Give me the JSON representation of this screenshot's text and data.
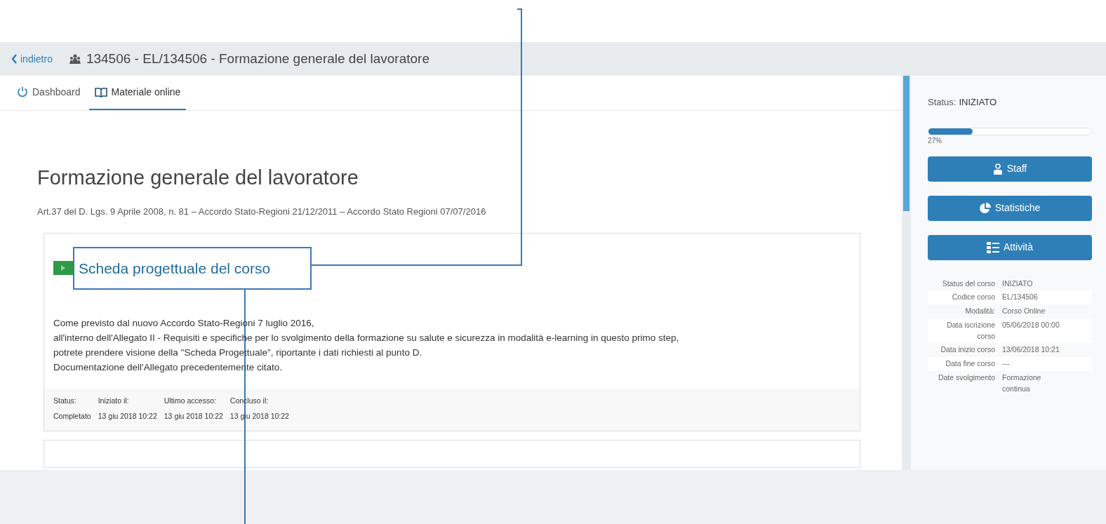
{
  "header": {
    "back_label": "indietro",
    "title": "134506 - EL/134506 - Formazione generale del lavoratore"
  },
  "tabs": [
    {
      "label": "Dashboard",
      "selected": false
    },
    {
      "label": "Materiale online",
      "selected": true
    }
  ],
  "course": {
    "title": "Formazione generale del lavoratore",
    "subtitle": "Art.37 del D. Lgs. 9 Aprile 2008, n. 81 – Accordo Stato-Regioni 21/12/2011 – Accordo Stato Regioni 07/07/2016"
  },
  "module": {
    "title": "Scheda progettuale del corso",
    "paragraph": [
      "Come previsto dal nuovo Accordo Stato-Regioni 7 luglio 2016,",
      "all'interno dell'Allegato II - Requisiti e specifiche per lo svolgimento della formazione su salute e sicurezza in modalità e-learning in questo primo step,",
      "potrete prendere visione della \"Scheda Progettuale\", riportante i dati richiesti al punto D.",
      "Documentazione dell'Allegato precedentemente citato."
    ],
    "footer": [
      {
        "label": "Status:",
        "value": "Completato"
      },
      {
        "label": "Iniziato il:",
        "value": "13 giu 2018 10:22"
      },
      {
        "label": "Ultimo accesso:",
        "value": "13 giu 2018 10:22"
      },
      {
        "label": "Concluso il:",
        "value": "13 giu 2018 10:22"
      }
    ]
  },
  "sidebar": {
    "status_label": "Status:",
    "status_value": "INIZIATO",
    "progress": {
      "level": 0.27,
      "reading": "27%"
    },
    "buttons": [
      {
        "label": "Staff"
      },
      {
        "label": "Statistiche"
      },
      {
        "label": "Attività"
      }
    ],
    "details": [
      {
        "label": "Status del corso",
        "value": "INIZIATO"
      },
      {
        "label": "Codice corso",
        "value": "EL/134506"
      },
      {
        "label": "Modalità:",
        "value": "Corso Online"
      },
      {
        "label": "Data iscrizione corso",
        "value": "05/06/2018 00:00"
      },
      {
        "label": "Data inizio corso",
        "value": "13/06/2018 10:21"
      },
      {
        "label": "Data fine corso",
        "value": "---"
      },
      {
        "label": "Date svolgimento",
        "value": "Formazione continua"
      }
    ]
  }
}
